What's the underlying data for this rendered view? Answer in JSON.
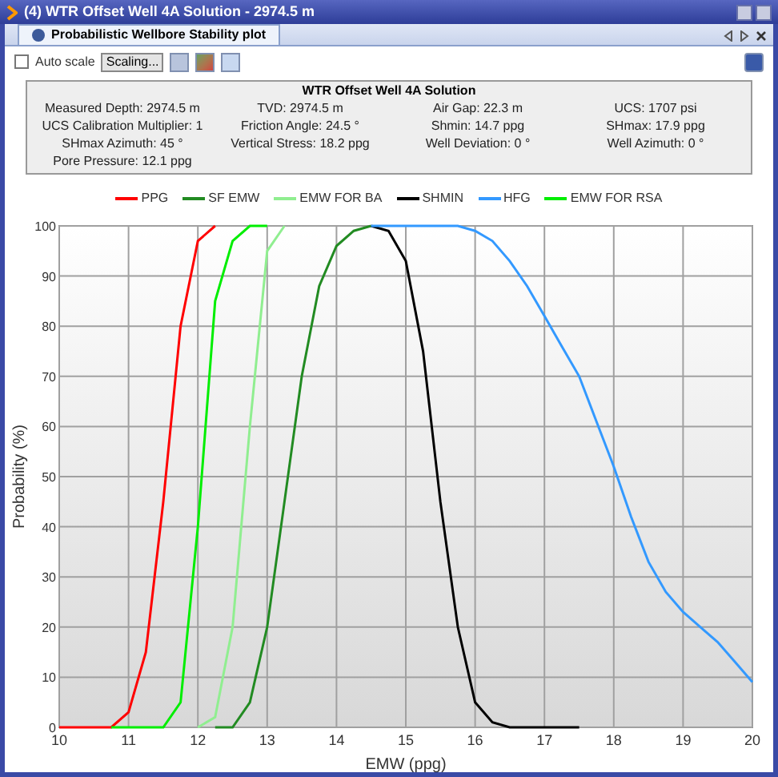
{
  "window": {
    "title": "(4) WTR Offset Well 4A Solution - 2974.5 m"
  },
  "tab": {
    "label": "Probabilistic Wellbore Stability plot",
    "selected": true
  },
  "toolbar": {
    "auto_scale": {
      "label": "Auto scale",
      "checked": false
    },
    "scaling_button": "Scaling..."
  },
  "info": {
    "title": "WTR Offset Well 4A Solution",
    "rows": [
      [
        "Measured Depth: 2974.5 m",
        "TVD: 2974.5 m",
        "Air Gap: 22.3 m",
        "UCS: 1707 psi"
      ],
      [
        "UCS Calibration Multiplier: 1",
        "Friction Angle: 24.5 °",
        "Shmin: 14.7 ppg",
        "SHmax: 17.9 ppg"
      ],
      [
        "SHmax Azimuth: 45 °",
        "Vertical Stress: 18.2 ppg",
        "Well Deviation: 0 °",
        "Well Azimuth: 0 °"
      ],
      [
        "Pore Pressure: 12.1 ppg"
      ]
    ]
  },
  "plot": {
    "chart_data": {
      "type": "line",
      "grid": true,
      "xlabel": "EMW (ppg)",
      "ylabel": "Probability (%)",
      "xlim": [
        10,
        20
      ],
      "ylim": [
        0,
        100
      ],
      "xticks": [
        10,
        11,
        12,
        13,
        14,
        15,
        16,
        17,
        18,
        19,
        20
      ],
      "yticks": [
        0,
        10,
        20,
        30,
        40,
        50,
        60,
        70,
        80,
        90,
        100
      ],
      "x": [
        10,
        10.25,
        10.5,
        10.75,
        11,
        11.25,
        11.5,
        11.75,
        12,
        12.25,
        12.5,
        12.75,
        13,
        13.25,
        13.5,
        13.75,
        14,
        14.25,
        14.5,
        14.75,
        15,
        15.25,
        15.5,
        15.75,
        16,
        16.25,
        16.5,
        16.75,
        17,
        17.25,
        17.5,
        17.75,
        18,
        18.25,
        18.5,
        18.75,
        19,
        19.25,
        19.5,
        19.75,
        20
      ],
      "series": [
        {
          "name": "PPG",
          "color": "#ff0000",
          "values": [
            0,
            0,
            0,
            0,
            3,
            15,
            45,
            80,
            97,
            100,
            null,
            null,
            null,
            null,
            null,
            null,
            null,
            null,
            null,
            null,
            null,
            null,
            null,
            null,
            null,
            null,
            null,
            null,
            null,
            null,
            null,
            null,
            null,
            null,
            null,
            null,
            null,
            null,
            null,
            null,
            null
          ]
        },
        {
          "name": "SF EMW",
          "color": "#228b22",
          "values": [
            null,
            null,
            null,
            null,
            null,
            null,
            null,
            null,
            null,
            0,
            0,
            5,
            20,
            45,
            70,
            88,
            96,
            99,
            100,
            null,
            null,
            null,
            null,
            null,
            null,
            null,
            null,
            null,
            null,
            null,
            null,
            null,
            null,
            null,
            null,
            null,
            null,
            null,
            null,
            null,
            null
          ]
        },
        {
          "name": "EMW FOR BA",
          "color": "#90ee90",
          "values": [
            null,
            null,
            null,
            null,
            null,
            null,
            null,
            null,
            0,
            2,
            20,
            60,
            95,
            100,
            null,
            null,
            null,
            null,
            null,
            null,
            null,
            null,
            null,
            null,
            null,
            null,
            null,
            null,
            null,
            null,
            null,
            null,
            null,
            null,
            null,
            null,
            null,
            null,
            null,
            null,
            null
          ]
        },
        {
          "name": "SHMIN",
          "color": "#000000",
          "values": [
            null,
            null,
            null,
            null,
            null,
            null,
            null,
            null,
            null,
            null,
            null,
            null,
            null,
            null,
            null,
            null,
            null,
            null,
            100,
            99,
            93,
            75,
            45,
            20,
            5,
            1,
            0,
            0,
            0,
            0,
            0,
            null,
            null,
            null,
            null,
            null,
            null,
            null,
            null,
            null,
            null
          ]
        },
        {
          "name": "HFG",
          "color": "#3399ff",
          "values": [
            null,
            null,
            null,
            null,
            null,
            null,
            null,
            null,
            null,
            null,
            null,
            null,
            null,
            null,
            null,
            null,
            null,
            null,
            100,
            100,
            100,
            100,
            100,
            100,
            99,
            97,
            93,
            88,
            82,
            76,
            70,
            61,
            52,
            42,
            33,
            27,
            23,
            20,
            17,
            13,
            9
          ]
        },
        {
          "name": "EMW FOR RSA",
          "color": "#00ee00",
          "values": [
            null,
            null,
            null,
            0,
            0,
            0,
            0,
            5,
            40,
            85,
            97,
            100,
            100,
            null,
            null,
            null,
            null,
            null,
            null,
            null,
            null,
            null,
            null,
            null,
            null,
            null,
            null,
            null,
            null,
            null,
            null,
            null,
            null,
            null,
            null,
            null,
            null,
            null,
            null,
            null,
            null
          ]
        }
      ]
    }
  }
}
